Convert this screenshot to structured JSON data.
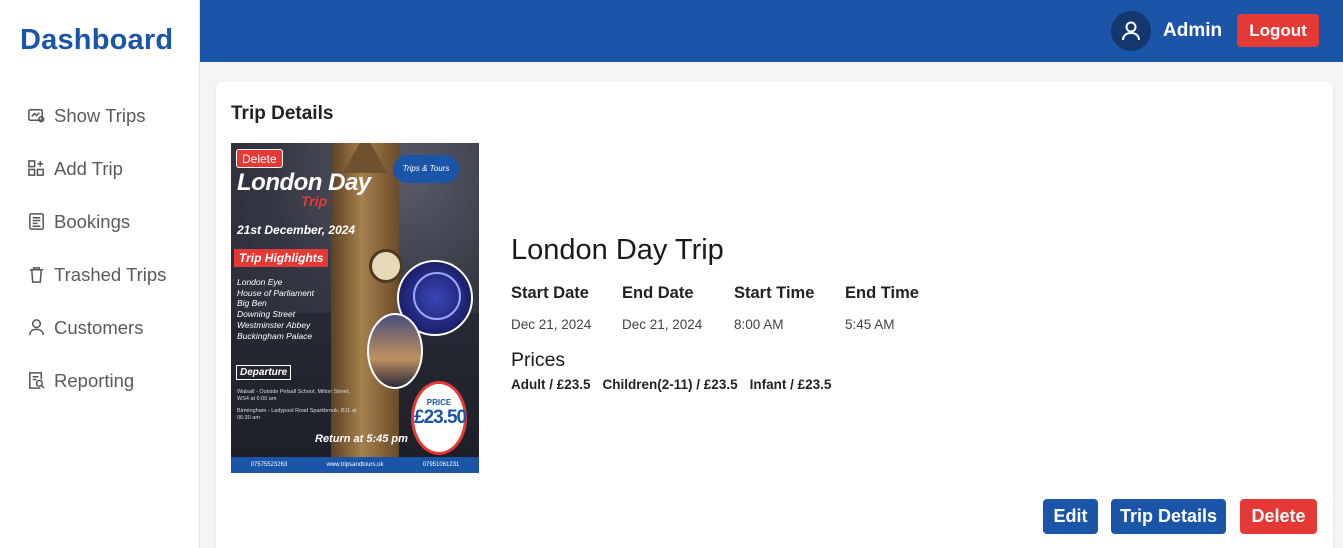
{
  "sidebar": {
    "brand": "Dashboard",
    "items": [
      {
        "label": "Show Trips",
        "icon": "show-trips-icon"
      },
      {
        "label": "Add Trip",
        "icon": "add-trip-icon"
      },
      {
        "label": "Bookings",
        "icon": "bookings-icon"
      },
      {
        "label": "Trashed Trips",
        "icon": "trash-icon"
      },
      {
        "label": "Customers",
        "icon": "user-icon"
      },
      {
        "label": "Reporting",
        "icon": "report-icon"
      }
    ]
  },
  "header": {
    "user_name": "Admin",
    "logout_label": "Logout",
    "accent_color": "#1a55a8",
    "danger_color": "#e53935"
  },
  "card": {
    "title": "Trip Details"
  },
  "poster": {
    "delete_label": "Delete",
    "logo_text": "Trips & Tours",
    "title": "London Day",
    "subtitle": "Trip",
    "date": "21st December, 2024",
    "highlights_label": "Trip Highlights",
    "highlights": [
      "London Eye",
      "House of Parliament",
      "Big Ben",
      "Downing Street",
      "Westminster Abbey",
      "Buckingham Palace"
    ],
    "departure_label": "Departure",
    "departure_info_1": "Walsall - Outside Pelsall School, Milton Street, WS4 at 6:00 am",
    "departure_info_2": "Birmingham - Ladypool Road Sparkbrook, B11 at 06:30 am",
    "return_text": "Return at 5:45 pm",
    "price_label": "PRICE",
    "price_value": "£23.50",
    "footer_phone_1": "07575523263",
    "footer_site": "www.tripsandtours.uk",
    "footer_phone_2": "07951061231"
  },
  "trip": {
    "name": "London Day Trip",
    "start_date_label": "Start Date",
    "end_date_label": "End Date",
    "start_time_label": "Start Time",
    "end_time_label": "End Time",
    "start_date": "Dec 21, 2024",
    "end_date": "Dec 21, 2024",
    "start_time": "8:00 AM",
    "end_time": "5:45 AM",
    "prices_title": "Prices",
    "prices": [
      "Adult / £23.5",
      "Children(2-11) / £23.5",
      "Infant / £23.5"
    ]
  },
  "actions": {
    "edit_label": "Edit",
    "details_label": "Trip Details",
    "delete_label": "Delete"
  }
}
